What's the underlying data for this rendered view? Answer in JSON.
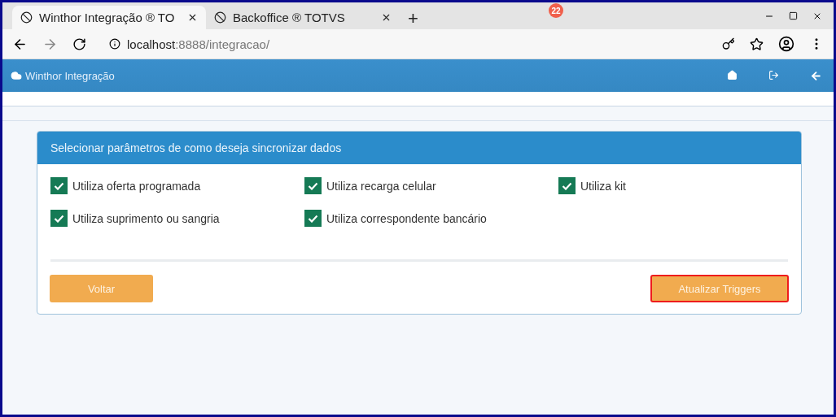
{
  "browser": {
    "tabs": [
      {
        "title": "Winthor Integração ® TO",
        "selected": true
      },
      {
        "title": "Backoffice ® TOTVS",
        "selected": false
      }
    ],
    "new_tab": "+",
    "overlay_badge": "22",
    "url": {
      "host": "localhost",
      "path": ":8888/integracao/"
    }
  },
  "app_header": {
    "title": "Winthor Integração"
  },
  "panel": {
    "title": "Selecionar parâmetros de como deseja sincronizar dados",
    "options": [
      {
        "label": "Utiliza oferta programada",
        "checked": true
      },
      {
        "label": "Utiliza recarga celular",
        "checked": true
      },
      {
        "label": "Utiliza kit",
        "checked": true
      },
      {
        "label": "Utiliza suprimento ou sangria",
        "checked": true
      },
      {
        "label": "Utiliza correspondente bancário",
        "checked": true
      }
    ],
    "buttons": [
      {
        "label": "Voltar",
        "highlighted": false
      },
      {
        "label": "Atualizar Triggers",
        "highlighted": true
      }
    ]
  }
}
